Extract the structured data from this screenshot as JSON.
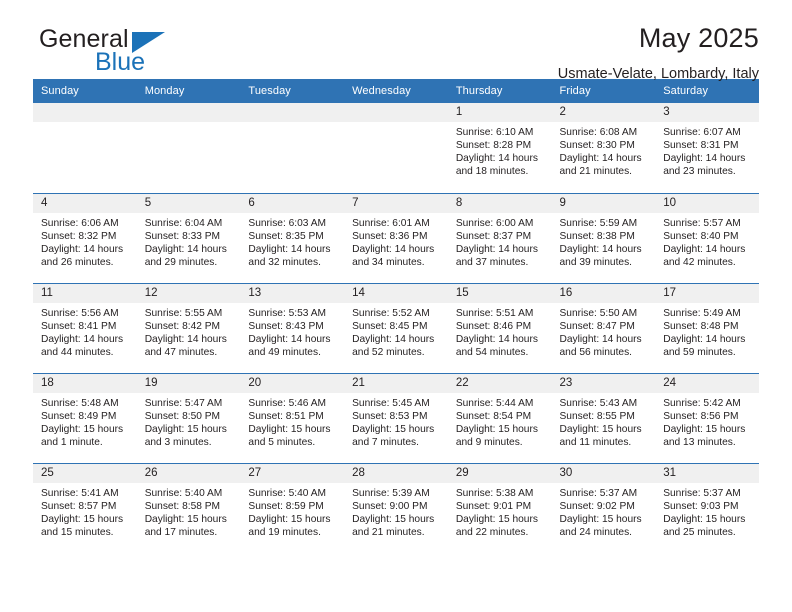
{
  "brand": {
    "name_top": "General",
    "name_bottom": "Blue"
  },
  "header": {
    "title": "May 2025",
    "subtitle": "Usmate-Velate, Lombardy, Italy"
  },
  "calendar": {
    "weekday_headers": [
      "Sunday",
      "Monday",
      "Tuesday",
      "Wednesday",
      "Thursday",
      "Friday",
      "Saturday"
    ],
    "accent_color": "#2f73b4",
    "daynum_band_color": "#f0f0f0",
    "weeks": [
      [
        {
          "day": "",
          "empty": true,
          "info": ""
        },
        {
          "day": "",
          "empty": true,
          "info": ""
        },
        {
          "day": "",
          "empty": true,
          "info": ""
        },
        {
          "day": "",
          "empty": true,
          "info": ""
        },
        {
          "day": "1",
          "empty": false,
          "info": "Sunrise: 6:10 AM\nSunset: 8:28 PM\nDaylight: 14 hours\nand 18 minutes."
        },
        {
          "day": "2",
          "empty": false,
          "info": "Sunrise: 6:08 AM\nSunset: 8:30 PM\nDaylight: 14 hours\nand 21 minutes."
        },
        {
          "day": "3",
          "empty": false,
          "info": "Sunrise: 6:07 AM\nSunset: 8:31 PM\nDaylight: 14 hours\nand 23 minutes."
        }
      ],
      [
        {
          "day": "4",
          "empty": false,
          "info": "Sunrise: 6:06 AM\nSunset: 8:32 PM\nDaylight: 14 hours\nand 26 minutes."
        },
        {
          "day": "5",
          "empty": false,
          "info": "Sunrise: 6:04 AM\nSunset: 8:33 PM\nDaylight: 14 hours\nand 29 minutes."
        },
        {
          "day": "6",
          "empty": false,
          "info": "Sunrise: 6:03 AM\nSunset: 8:35 PM\nDaylight: 14 hours\nand 32 minutes."
        },
        {
          "day": "7",
          "empty": false,
          "info": "Sunrise: 6:01 AM\nSunset: 8:36 PM\nDaylight: 14 hours\nand 34 minutes."
        },
        {
          "day": "8",
          "empty": false,
          "info": "Sunrise: 6:00 AM\nSunset: 8:37 PM\nDaylight: 14 hours\nand 37 minutes."
        },
        {
          "day": "9",
          "empty": false,
          "info": "Sunrise: 5:59 AM\nSunset: 8:38 PM\nDaylight: 14 hours\nand 39 minutes."
        },
        {
          "day": "10",
          "empty": false,
          "info": "Sunrise: 5:57 AM\nSunset: 8:40 PM\nDaylight: 14 hours\nand 42 minutes."
        }
      ],
      [
        {
          "day": "11",
          "empty": false,
          "info": "Sunrise: 5:56 AM\nSunset: 8:41 PM\nDaylight: 14 hours\nand 44 minutes."
        },
        {
          "day": "12",
          "empty": false,
          "info": "Sunrise: 5:55 AM\nSunset: 8:42 PM\nDaylight: 14 hours\nand 47 minutes."
        },
        {
          "day": "13",
          "empty": false,
          "info": "Sunrise: 5:53 AM\nSunset: 8:43 PM\nDaylight: 14 hours\nand 49 minutes."
        },
        {
          "day": "14",
          "empty": false,
          "info": "Sunrise: 5:52 AM\nSunset: 8:45 PM\nDaylight: 14 hours\nand 52 minutes."
        },
        {
          "day": "15",
          "empty": false,
          "info": "Sunrise: 5:51 AM\nSunset: 8:46 PM\nDaylight: 14 hours\nand 54 minutes."
        },
        {
          "day": "16",
          "empty": false,
          "info": "Sunrise: 5:50 AM\nSunset: 8:47 PM\nDaylight: 14 hours\nand 56 minutes."
        },
        {
          "day": "17",
          "empty": false,
          "info": "Sunrise: 5:49 AM\nSunset: 8:48 PM\nDaylight: 14 hours\nand 59 minutes."
        }
      ],
      [
        {
          "day": "18",
          "empty": false,
          "info": "Sunrise: 5:48 AM\nSunset: 8:49 PM\nDaylight: 15 hours\nand 1 minute."
        },
        {
          "day": "19",
          "empty": false,
          "info": "Sunrise: 5:47 AM\nSunset: 8:50 PM\nDaylight: 15 hours\nand 3 minutes."
        },
        {
          "day": "20",
          "empty": false,
          "info": "Sunrise: 5:46 AM\nSunset: 8:51 PM\nDaylight: 15 hours\nand 5 minutes."
        },
        {
          "day": "21",
          "empty": false,
          "info": "Sunrise: 5:45 AM\nSunset: 8:53 PM\nDaylight: 15 hours\nand 7 minutes."
        },
        {
          "day": "22",
          "empty": false,
          "info": "Sunrise: 5:44 AM\nSunset: 8:54 PM\nDaylight: 15 hours\nand 9 minutes."
        },
        {
          "day": "23",
          "empty": false,
          "info": "Sunrise: 5:43 AM\nSunset: 8:55 PM\nDaylight: 15 hours\nand 11 minutes."
        },
        {
          "day": "24",
          "empty": false,
          "info": "Sunrise: 5:42 AM\nSunset: 8:56 PM\nDaylight: 15 hours\nand 13 minutes."
        }
      ],
      [
        {
          "day": "25",
          "empty": false,
          "info": "Sunrise: 5:41 AM\nSunset: 8:57 PM\nDaylight: 15 hours\nand 15 minutes."
        },
        {
          "day": "26",
          "empty": false,
          "info": "Sunrise: 5:40 AM\nSunset: 8:58 PM\nDaylight: 15 hours\nand 17 minutes."
        },
        {
          "day": "27",
          "empty": false,
          "info": "Sunrise: 5:40 AM\nSunset: 8:59 PM\nDaylight: 15 hours\nand 19 minutes."
        },
        {
          "day": "28",
          "empty": false,
          "info": "Sunrise: 5:39 AM\nSunset: 9:00 PM\nDaylight: 15 hours\nand 21 minutes."
        },
        {
          "day": "29",
          "empty": false,
          "info": "Sunrise: 5:38 AM\nSunset: 9:01 PM\nDaylight: 15 hours\nand 22 minutes."
        },
        {
          "day": "30",
          "empty": false,
          "info": "Sunrise: 5:37 AM\nSunset: 9:02 PM\nDaylight: 15 hours\nand 24 minutes."
        },
        {
          "day": "31",
          "empty": false,
          "info": "Sunrise: 5:37 AM\nSunset: 9:03 PM\nDaylight: 15 hours\nand 25 minutes."
        }
      ]
    ]
  }
}
